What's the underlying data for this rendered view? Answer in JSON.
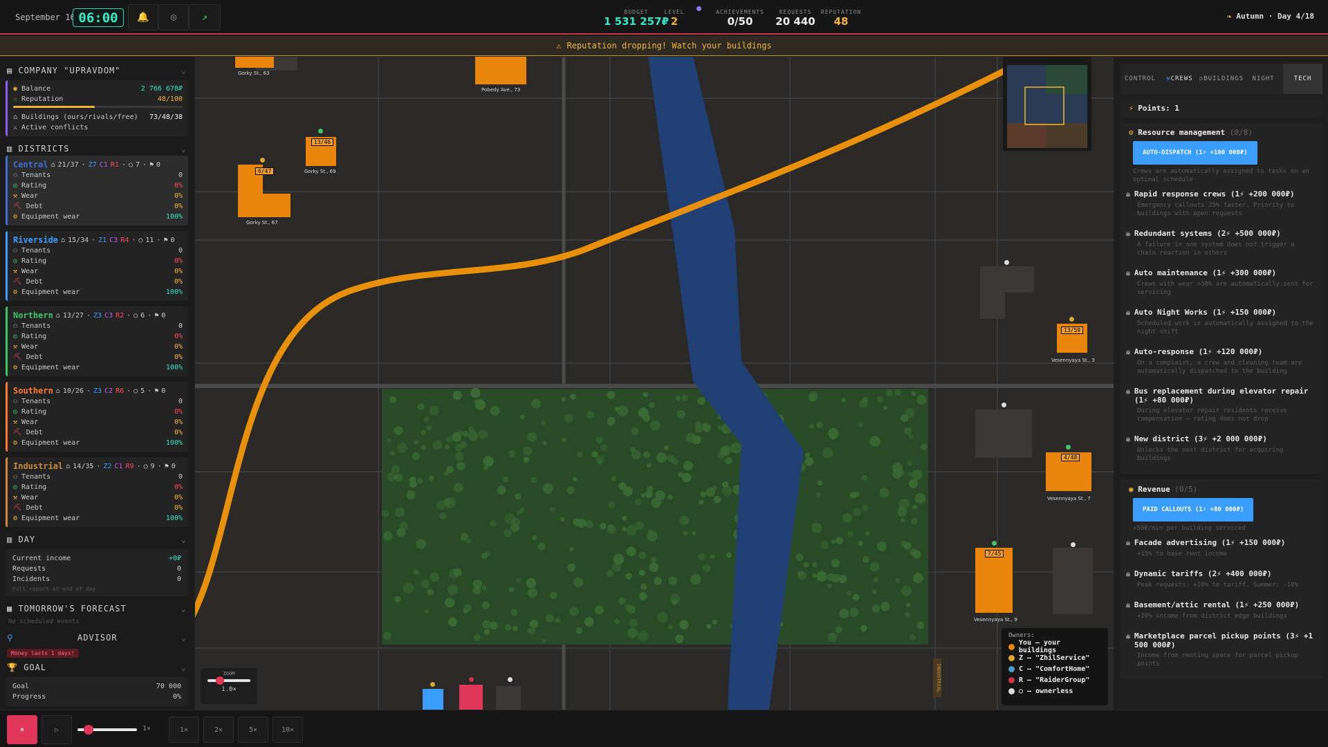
{
  "topbar": {
    "date": "September 16",
    "clock": "06:00",
    "bell_icon": "bell-icon",
    "budget_label": "BUDGET",
    "budget_value": "1 531 257₽",
    "level_label": "LEVEL",
    "level_value": "2",
    "achievements_label": "ACHIEVEMENTS",
    "achievements_value": "0/50",
    "requests_label": "REQUESTS",
    "requests_value": "20 440",
    "reputation_label": "REPUTATION",
    "reputation_value": "48",
    "season": "Autumn · Day 4/18"
  },
  "warning": "Reputation dropping! Watch your buildings",
  "company": {
    "title": "COMPANY \"UPRAVDOM\"",
    "balance_label": "Balance",
    "balance_value": "2 766 678₽",
    "reputation_label": "Reputation",
    "reputation_value": "48/100",
    "reputation_fraction": 0.48,
    "buildings_label": "Buildings (ours/rivals/free)",
    "buildings_value": "73/48/38",
    "conflicts_label": "Active conflicts"
  },
  "districts_title": "DISTRICTS",
  "districts": [
    {
      "name": "Central",
      "color": "#3b6fd4",
      "stats": "21/37",
      "z": "Z7",
      "c": "C1",
      "r": "R1",
      "free": "7",
      "extra": "0",
      "tenants": "0",
      "rating": "0%",
      "wear": "0%",
      "debt": "0%",
      "equip": "100%"
    },
    {
      "name": "Riverside",
      "color": "#3b9eff",
      "stats": "15/34",
      "z": "Z1",
      "c": "C3",
      "r": "R4",
      "free": "11",
      "extra": "0",
      "tenants": "0",
      "rating": "0%",
      "wear": "0%",
      "debt": "0%",
      "equip": "100%"
    },
    {
      "name": "Northern",
      "color": "#3fc46a",
      "stats": "13/27",
      "z": "Z3",
      "c": "C3",
      "r": "R2",
      "free": "6",
      "extra": "0",
      "tenants": "0",
      "rating": "0%",
      "wear": "0%",
      "debt": "0%",
      "equip": "100%"
    },
    {
      "name": "Southern",
      "color": "#ff7a2a",
      "stats": "10/26",
      "z": "Z3",
      "c": "C2",
      "r": "R6",
      "free": "5",
      "extra": "0",
      "tenants": "0",
      "rating": "0%",
      "wear": "0%",
      "debt": "0%",
      "equip": "100%"
    },
    {
      "name": "Industrial",
      "color": "#c98a3a",
      "stats": "14/35",
      "z": "Z2",
      "c": "C1",
      "r": "R9",
      "free": "9",
      "extra": "0",
      "tenants": "0",
      "rating": "0%",
      "wear": "0%",
      "debt": "0%",
      "equip": "100%"
    }
  ],
  "labels": {
    "tenants": "Tenants",
    "rating": "Rating",
    "wear": "Wear",
    "debt": "Debt",
    "equip": "Equipment wear"
  },
  "day": {
    "title": "DAY",
    "income_label": "Current income",
    "income_value": "+0₽",
    "requests_label": "Requests",
    "requests_value": "0",
    "incidents_label": "Incidents",
    "incidents_value": "0",
    "note": "Full report at end of day"
  },
  "forecast": {
    "title": "TOMORROW'S FORECAST",
    "note": "No scheduled events"
  },
  "advisor": {
    "title": "ADVISOR",
    "badge": "Money lasts 1 days!"
  },
  "goal": {
    "title": "GOAL",
    "goal_label": "Goal",
    "goal_value": "70 000",
    "progress_label": "Progress",
    "progress_value": "0%"
  },
  "map": {
    "buildings": [
      {
        "label": "Gorky St., 63"
      },
      {
        "label": "Pobedy Ave., 73"
      },
      {
        "label": "Gorky St., 69",
        "occ": "13/46"
      },
      {
        "label": "Gorky St., 67",
        "occ": "6/47"
      },
      {
        "label": "Vesennyaya St., 3",
        "occ": "13/59"
      },
      {
        "label": "Vesennyaya St., 7",
        "occ": "4/48"
      },
      {
        "label": "Vesennyaya St., 9",
        "occ": "7/45"
      }
    ],
    "industrial_label": "INDUSTRIAL",
    "zoom_label": "ZOOM",
    "zoom_value": "1.0×",
    "zoom_fraction": 0.2,
    "legend_title": "Owners:",
    "legend": [
      {
        "text": "You — your buildings",
        "color": "#e8850a"
      },
      {
        "text": "Z — \"ZhilService\"",
        "color": "#d9a830"
      },
      {
        "text": "C — \"ComfortHome\"",
        "color": "#4d9bcc"
      },
      {
        "text": "R — \"RaiderGroup\"",
        "color": "#cc3344"
      },
      {
        "text": "○ — ownerless",
        "color": "#dddddd"
      }
    ]
  },
  "tabs": [
    {
      "label": "CONTROL"
    },
    {
      "label": "CREWS"
    },
    {
      "label": "BUILDINGS"
    },
    {
      "label": "NIGHT"
    },
    {
      "label": "TECH"
    }
  ],
  "points": "Points: 1",
  "resource": {
    "title": "Resource management",
    "count": "(0/8)",
    "active": {
      "label": "AUTO-DISPATCH (1⚡ +100 000₽)",
      "desc": "Crews are automatically assigned to tasks on an optimal schedule"
    },
    "items": [
      {
        "label": "Rapid response crews (1⚡ +200 000₽)",
        "desc": "Emergency callouts 25% faster. Priority to buildings with open requests"
      },
      {
        "label": "Redundant systems (2⚡ +500 000₽)",
        "desc": "A failure in one system does not trigger a chain reaction in others"
      },
      {
        "label": "Auto maintenance (1⚡ +300 000₽)",
        "desc": "Crews with wear >30% are automatically sent for servicing"
      },
      {
        "label": "Auto Night Works (1⚡ +150 000₽)",
        "desc": "Scheduled work is automatically assigned to the night shift"
      },
      {
        "label": "Auto-response (1⚡ +120 000₽)",
        "desc": "On a complaint, a crew and cleaning team are automatically dispatched to the building"
      },
      {
        "label": "Bus replacement during elevator repair (1⚡ +80 000₽)",
        "desc": "During elevator repair residents receive compensation — rating does not drop"
      },
      {
        "label": "New district (3⚡ +2 000 000₽)",
        "desc": "Unlocks the next district for acquiring buildings"
      }
    ]
  },
  "revenue": {
    "title": "Revenue",
    "count": "(0/5)",
    "active": {
      "label": "PAID CALLOUTS (1⚡ +80 000₽)",
      "desc": "+50₽/min per building serviced"
    },
    "items": [
      {
        "label": "Facade advertising (1⚡ +150 000₽)",
        "desc": "+15% to base rent income"
      },
      {
        "label": "Dynamic tariffs (2⚡ +400 000₽)",
        "desc": "Peak requests: +20% to tariff. Summer: -10%"
      },
      {
        "label": "Basement/attic rental (1⚡ +250 000₽)",
        "desc": "+20% income from district edge buildings"
      },
      {
        "label": "Marketplace parcel pickup points (3⚡ +1 500 000₽)",
        "desc": "Income from renting space for parcel pickup points"
      }
    ]
  },
  "bottom": {
    "pause_icon": "pause-icon",
    "play_icon": "play-icon",
    "speed_value": "1×",
    "speed_fraction": 0.1,
    "speeds": [
      "1×",
      "2×",
      "5×",
      "10×"
    ]
  }
}
